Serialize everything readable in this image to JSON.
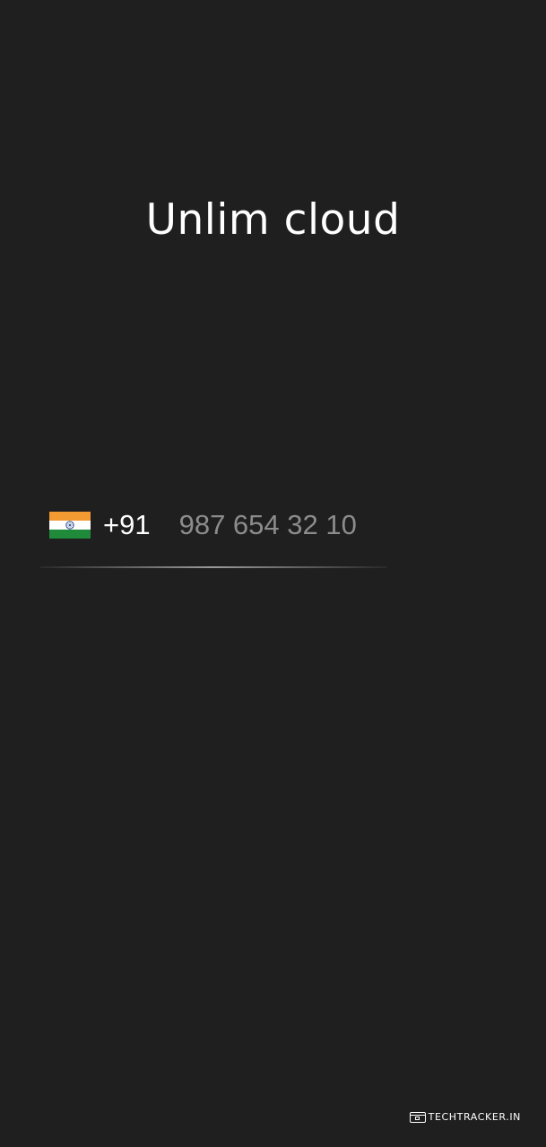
{
  "app": {
    "title": "Unlim cloud"
  },
  "phone": {
    "country_flag_icon": "india-flag-icon",
    "country_code": "+91",
    "input_value": "",
    "input_placeholder": "987 654 32 10"
  },
  "watermark": {
    "text": "TECHTRACKER.IN",
    "icon": "browser-window-icon"
  },
  "colors": {
    "background": "#1f1f1f",
    "text_primary": "#ffffff",
    "placeholder": "#8c8c8c",
    "flag_saffron": "#f39a33",
    "flag_white": "#ffffff",
    "flag_green": "#1f8a3a",
    "flag_chakra": "#1a3a8a"
  }
}
